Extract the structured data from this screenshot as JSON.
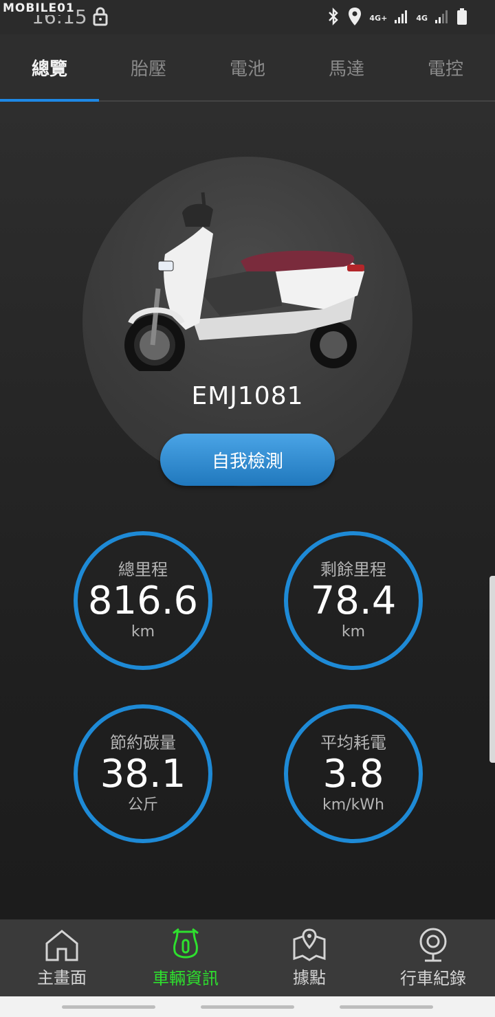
{
  "watermark": "MOBILE01",
  "status": {
    "time": "16:15",
    "net1": "4G+",
    "net2": "4G",
    "icons": [
      "lock-icon",
      "bluetooth-icon",
      "location-icon",
      "signal-icon",
      "battery-icon"
    ]
  },
  "tabs": [
    {
      "label": "總覽",
      "active": true
    },
    {
      "label": "胎壓"
    },
    {
      "label": "電池"
    },
    {
      "label": "馬達"
    },
    {
      "label": "電控"
    }
  ],
  "vehicle": {
    "model": "EMJ1081",
    "self_test_label": "自我檢測"
  },
  "stats": [
    {
      "label": "總里程",
      "value": "816.6",
      "unit": "km"
    },
    {
      "label": "剩餘里程",
      "value": "78.4",
      "unit": "km"
    },
    {
      "label": "節約碳量",
      "value": "38.1",
      "unit": "公斤"
    },
    {
      "label": "平均耗電",
      "value": "3.8",
      "unit": "km/kWh"
    }
  ],
  "bottom_nav": [
    {
      "label": "主畫面",
      "icon": "home-icon"
    },
    {
      "label": "車輛資訊",
      "icon": "scooter-icon",
      "active": true
    },
    {
      "label": "據點",
      "icon": "map-pin-icon"
    },
    {
      "label": "行車紀錄",
      "icon": "dashcam-icon"
    }
  ],
  "colors": {
    "accent": "#1e88e5",
    "active_nav": "#2ee02e"
  }
}
